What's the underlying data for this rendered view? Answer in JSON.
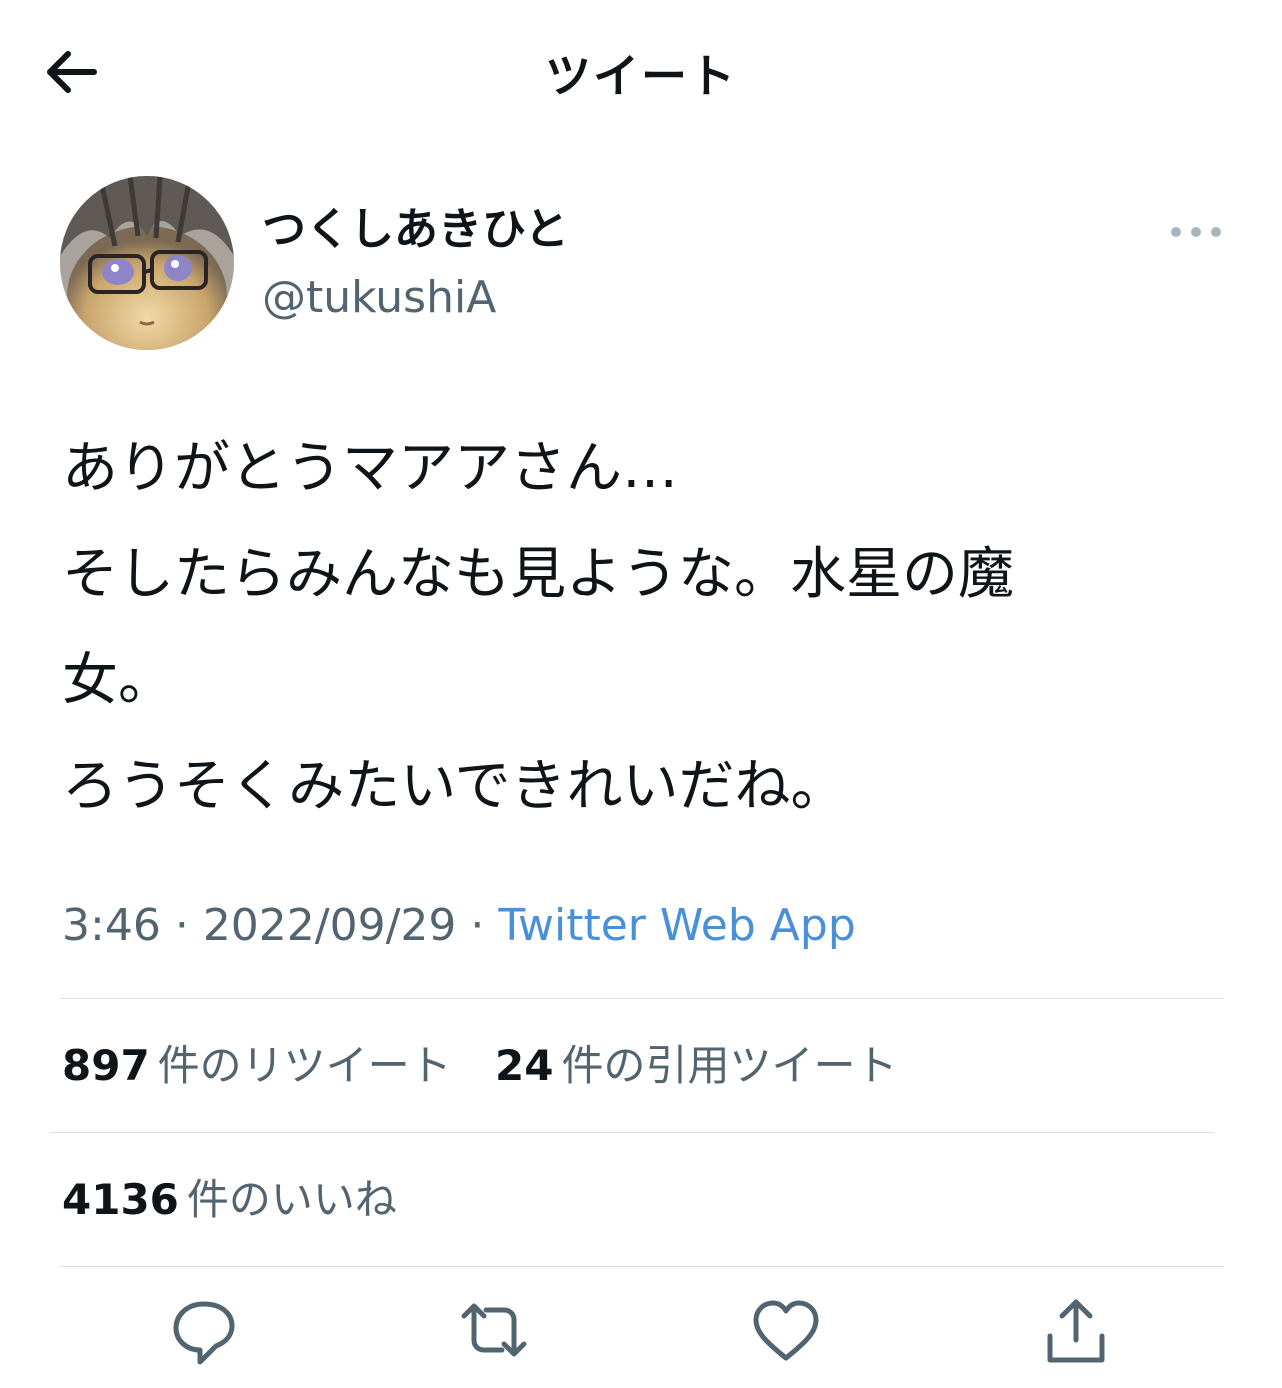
{
  "header": {
    "title": "ツイート",
    "back_icon": "arrow-left-icon"
  },
  "tweet": {
    "author": {
      "name": "つくしあきひと",
      "handle": "@tukushiA"
    },
    "more_icon": "more-horizontal-icon",
    "lines": [
      "ありがとうマアアさん…",
      "そしたらみんなも見ような。水星の魔",
      "女。",
      "ろうそくみたいできれいだね。"
    ],
    "time": "3:46",
    "date": "2022/09/29",
    "separator": "·",
    "source": "Twitter Web App"
  },
  "stats": {
    "retweets": {
      "count": "897",
      "label": "件のリツイート"
    },
    "quotes": {
      "count": "24",
      "label": "件の引用ツイート"
    },
    "likes": {
      "count": "4136",
      "label": "件のいいね"
    }
  },
  "actions": {
    "reply_icon": "reply-icon",
    "retweet_icon": "retweet-icon",
    "like_icon": "heart-icon",
    "share_icon": "share-icon"
  },
  "colors": {
    "text_primary": "#0f1419",
    "text_secondary": "#536471",
    "link": "#4a90d9",
    "divider": "#dcdfe2"
  }
}
